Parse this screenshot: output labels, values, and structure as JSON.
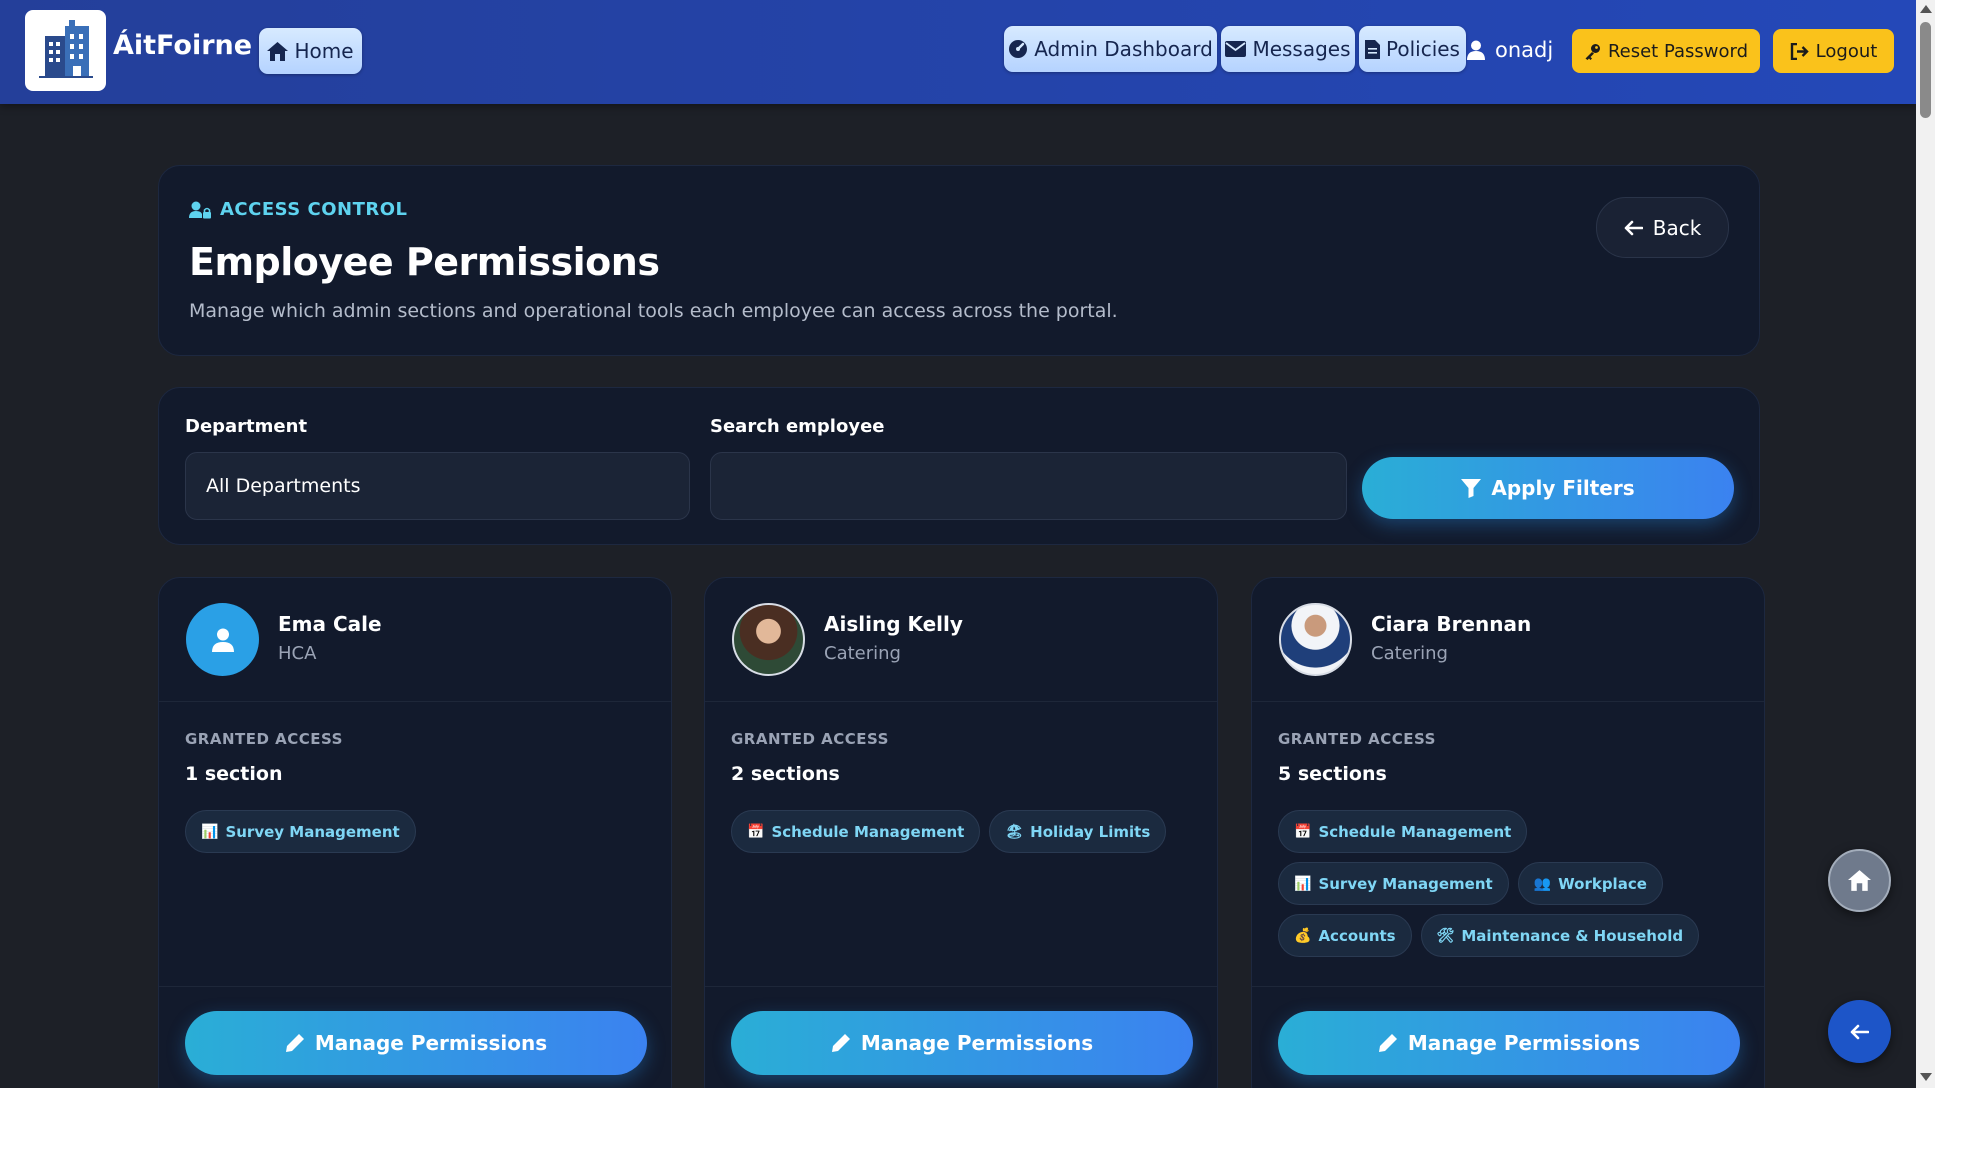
{
  "nav": {
    "brand": "ÁitFoirne",
    "home": "Home",
    "admin_dashboard": "Admin Dashboard",
    "messages": "Messages",
    "policies": "Policies",
    "username": "onadj",
    "reset_password": "Reset Password",
    "logout": "Logout"
  },
  "header": {
    "eyebrow": "ACCESS CONTROL",
    "title": "Employee Permissions",
    "subtitle": "Manage which admin sections and operational tools each employee can access across the portal.",
    "back": "Back"
  },
  "filters": {
    "department_label": "Department",
    "department_value": "All Departments",
    "search_label": "Search employee",
    "search_value": "",
    "apply": "Apply Filters"
  },
  "employees": [
    {
      "name": "Ema Cale",
      "department": "HCA",
      "granted_label": "GRANTED ACCESS",
      "count": "1 section",
      "tags": [
        {
          "icon": "bar-chart-icon",
          "label": "Survey Management"
        }
      ],
      "manage": "Manage Permissions"
    },
    {
      "name": "Aisling Kelly",
      "department": "Catering",
      "granted_label": "GRANTED ACCESS",
      "count": "2 sections",
      "tags": [
        {
          "icon": "calendar-icon",
          "label": "Schedule Management"
        },
        {
          "icon": "beach-icon",
          "label": "Holiday Limits"
        }
      ],
      "manage": "Manage Permissions"
    },
    {
      "name": "Ciara Brennan",
      "department": "Catering",
      "granted_label": "GRANTED ACCESS",
      "count": "5 sections",
      "tags": [
        {
          "icon": "calendar-icon",
          "label": "Schedule Management"
        },
        {
          "icon": "bar-chart-icon",
          "label": "Survey Management"
        },
        {
          "icon": "people-icon",
          "label": "Workplace"
        },
        {
          "icon": "money-bag-icon",
          "label": "Accounts"
        },
        {
          "icon": "tools-icon",
          "label": "Maintenance & Household"
        }
      ],
      "manage": "Manage Permissions"
    }
  ],
  "colors": {
    "nav": "#2448b8",
    "accent": "#5ed3ef",
    "button_gradient_start": "#2aaed6",
    "button_gradient_end": "#3b82f0",
    "yellow": "#fac21b"
  }
}
